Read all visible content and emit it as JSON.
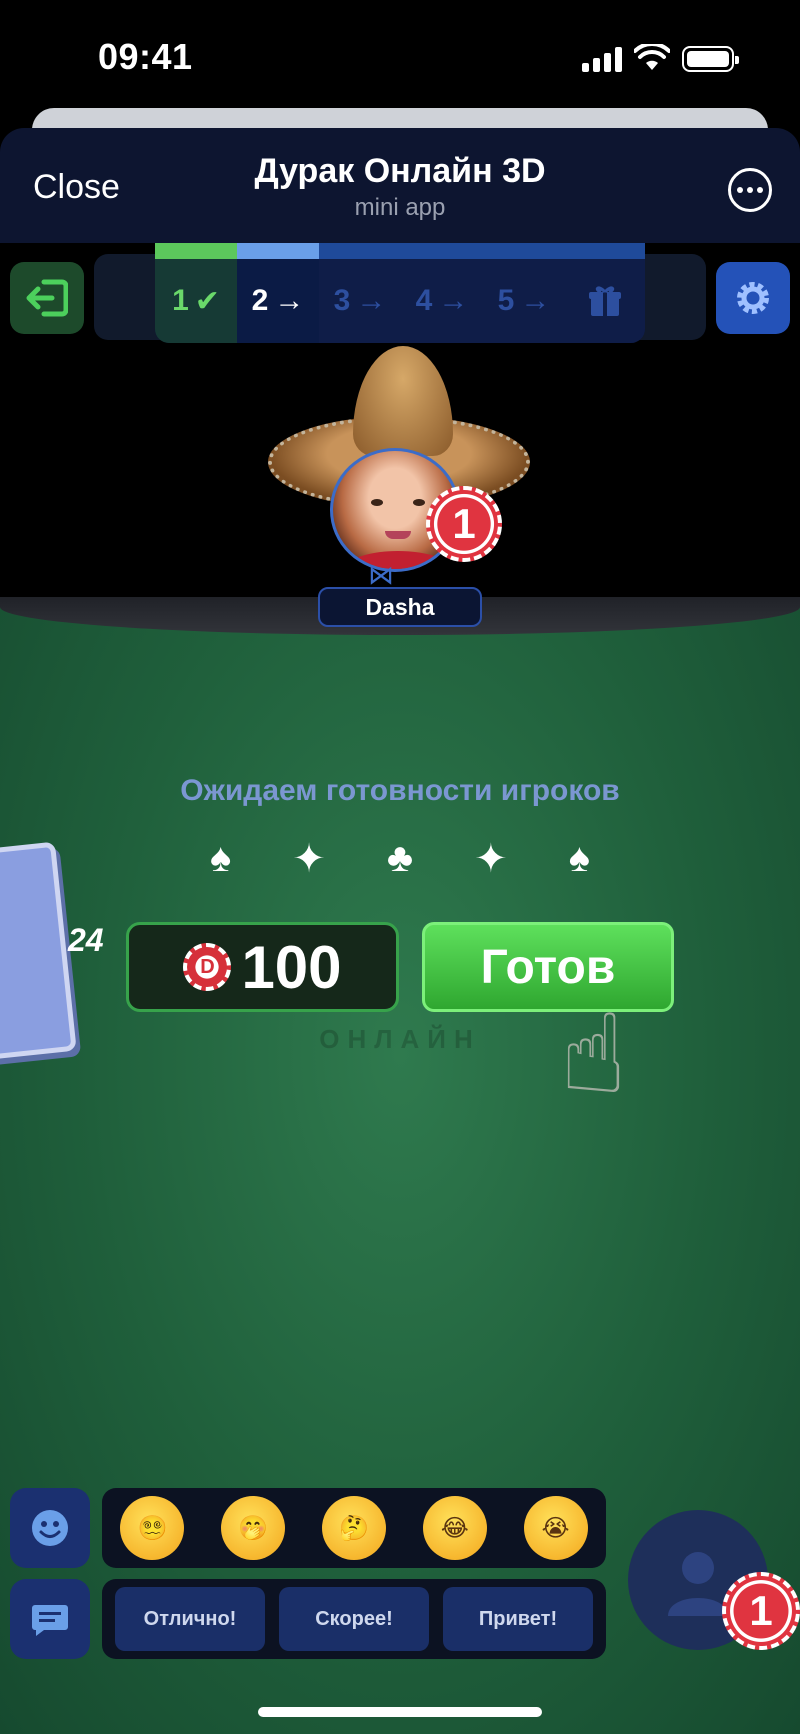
{
  "status_bar": {
    "time": "09:41"
  },
  "header": {
    "close_label": "Close",
    "title": "Дурак Онлайн 3D",
    "subtitle": "mini app"
  },
  "progress": {
    "steps": [
      {
        "label": "1",
        "state": "done",
        "icon": "check-icon"
      },
      {
        "label": "2",
        "state": "active",
        "icon": "arrow-right-icon"
      },
      {
        "label": "3",
        "state": "pending",
        "icon": "arrow-right-icon"
      },
      {
        "label": "4",
        "state": "pending",
        "icon": "arrow-right-icon"
      },
      {
        "label": "5",
        "state": "pending",
        "icon": "arrow-right-icon"
      }
    ],
    "reward_icon": "gift-icon",
    "colors": {
      "done": "#5cc85c",
      "active": "#6a9fe8",
      "pending": "#1f4a9a"
    }
  },
  "opponent": {
    "name": "Dasha",
    "badge": "1",
    "hat_icon": "sombrero-icon"
  },
  "table": {
    "status_text": "Ожидаем готовности игроков",
    "suits": [
      "♠",
      "✦",
      "♣",
      "✦",
      "♠"
    ],
    "watermark": "ОНЛАЙН",
    "deck_count": "24",
    "bet": {
      "chip_letter": "D",
      "value": "100"
    },
    "ready_label": "Готов",
    "felt_color": "#256b42"
  },
  "bottom": {
    "emojis": [
      "😵‍💫",
      "🤭",
      "🤔",
      "😂",
      "😭"
    ],
    "phrases": [
      "Отлично!",
      "Скорее!",
      "Привет!"
    ],
    "player_badge": "1"
  }
}
